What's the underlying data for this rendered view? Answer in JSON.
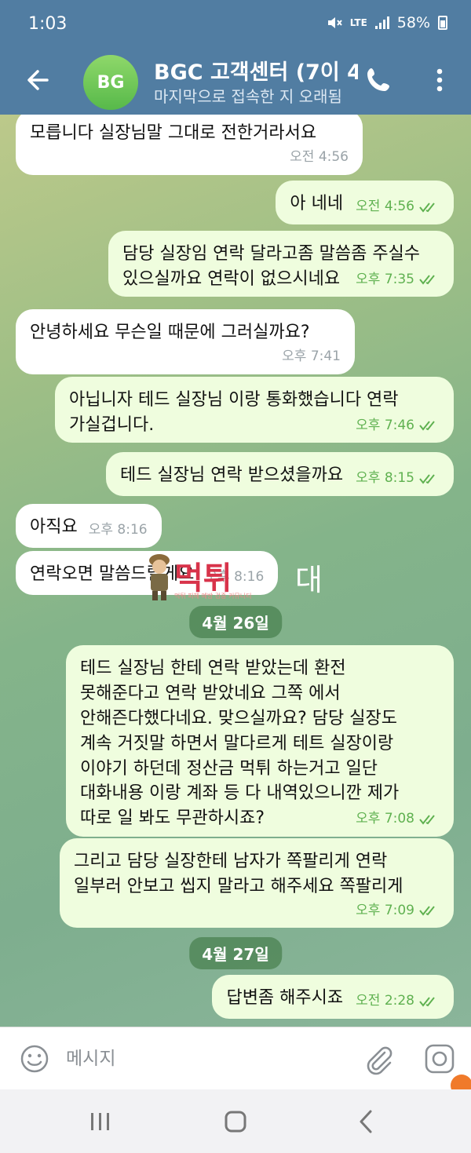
{
  "status": {
    "time": "1:03",
    "network": "LTE",
    "battery": "58%"
  },
  "header": {
    "avatar_initials": "BG",
    "title": "BGC 고객센터 (7이 4",
    "subtitle": "마지막으로 접속한 지 오래됨",
    "icons": [
      "arrow-back-icon",
      "phone-icon",
      "more-vert-icon"
    ]
  },
  "messages": [
    {
      "dir": "in",
      "text": "모릅니다 실장님말 그대로 전한거라서요",
      "time": "오전 4:56"
    },
    {
      "dir": "out",
      "text": "아 네네",
      "time": "오전 4:56"
    },
    {
      "dir": "out",
      "text": "담당 실장임 연락 달라고좀 말씀좀 주실수\n있으실까요 연락이 없으시네요",
      "time": "오후 7:35"
    },
    {
      "dir": "in",
      "text": "안녕하세요 무슨일 때문에 그러실까요?",
      "time": "오후 7:41"
    },
    {
      "dir": "out",
      "text": "아닙니자 테드 실장님 이랑 통화했습니다 연락\n가실겁니다.",
      "time": "오후 7:46"
    },
    {
      "dir": "out",
      "text": "테드 실장님 연락 받으셨을까요",
      "time": "오후 8:15"
    },
    {
      "dir": "in",
      "text": "아직요",
      "time": "오후 8:16"
    },
    {
      "dir": "in",
      "text": "연락오면 말씀드릴게요",
      "time": "오후 8:16"
    },
    {
      "dir": "out",
      "text": "테드 실장님 한테 연락 받았는데 환전\n못해준다고 연락 받았네요 그쪽 에서\n안해즌다했다네요. 맞으실까요? 담당 실장도\n계속 거짓말 하면서 말다르게 테트 실장이랑\n이야기 하던데 정산금 먹튀 하는거고 일단\n대화내용 이랑 계좌 등 다 내역있으니깐 제가\n따로 일 봐도 무관하시죠?",
      "time": "오후 7:08"
    },
    {
      "dir": "out",
      "text": "그리고 담당 실장한테 남자가 쪽팔리게 연락\n일부러 안보고 씹지 말라고 해주세요 쪽팔리게",
      "time": "오후 7:09"
    },
    {
      "dir": "out",
      "text": "답변좀 해주시죠",
      "time": "오전 2:28"
    }
  ],
  "dates": [
    "4월 26일",
    "4월 27일"
  ],
  "watermark": {
    "big": "먹튀",
    "big2": "대",
    "small": "먹튀 피해 예방 검증 커뮤니티"
  },
  "input": {
    "placeholder": "메시지"
  }
}
